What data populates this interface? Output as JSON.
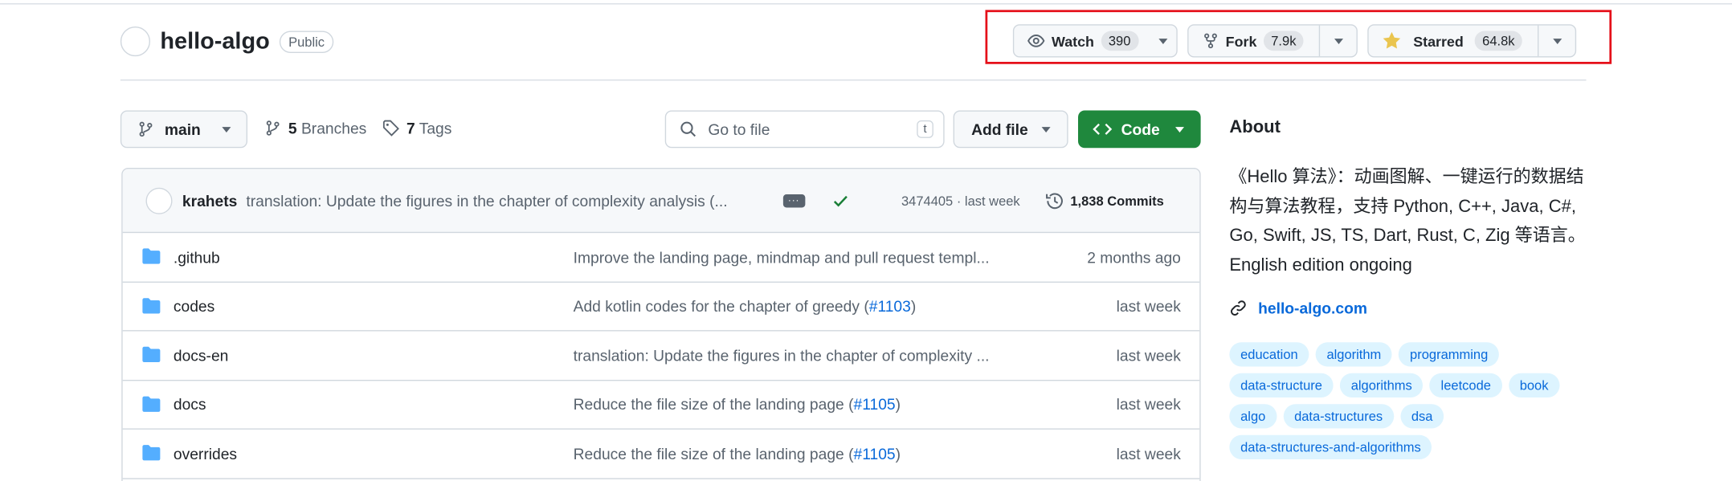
{
  "repo": {
    "name": "hello-algo",
    "visibility": "Public"
  },
  "actions": {
    "watch": {
      "label": "Watch",
      "count": "390",
      "icon": "eye-icon"
    },
    "fork": {
      "label": "Fork",
      "count": "7.9k",
      "icon": "repo-forked-icon"
    },
    "star": {
      "label": "Starred",
      "count": "64.8k",
      "icon": "star-fill-icon",
      "icon_color": "#eac54f"
    }
  },
  "toolbar": {
    "branch": "main",
    "branches_count": "5",
    "branches_label": "Branches",
    "tags_count": "7",
    "tags_label": "Tags",
    "search_placeholder": "Go to file",
    "search_shortcut": "t",
    "add_file_label": "Add file",
    "code_label": "Code"
  },
  "latest_commit": {
    "author": "krahets",
    "message": "translation: Update the figures in the chapter of complexity analysis (...",
    "sha_time": "3474405 · last week",
    "commits_count": "1,838 Commits"
  },
  "files": [
    {
      "name": ".github",
      "message": "Improve the landing page, mindmap and pull request templ...",
      "pr": "",
      "suffix": "",
      "time": "2 months ago"
    },
    {
      "name": "codes",
      "message": "Add kotlin codes for the chapter of greedy (",
      "pr": "#1103",
      "suffix": ")",
      "time": "last week"
    },
    {
      "name": "docs-en",
      "message": "translation: Update the figures in the chapter of complexity ...",
      "pr": "",
      "suffix": "",
      "time": "last week"
    },
    {
      "name": "docs",
      "message": "Reduce the file size of the landing page (",
      "pr": "#1105",
      "suffix": ")",
      "time": "last week"
    },
    {
      "name": "overrides",
      "message": "Reduce the file size of the landing page (",
      "pr": "#1105",
      "suffix": ")",
      "time": "last week"
    }
  ],
  "about": {
    "title": "About",
    "description": "《Hello 算法》：动画图解、一键运行的数据结构与算法教程，支持 Python, C++, Java, C#, Go, Swift, JS, TS, Dart, Rust, C, Zig 等语言。English edition ongoing",
    "website": "hello-algo.com",
    "topics": [
      "education",
      "algorithm",
      "programming",
      "data-structure",
      "algorithms",
      "leetcode",
      "book",
      "algo",
      "data-structures",
      "dsa",
      "data-structures-and-algorithms"
    ]
  },
  "colors": {
    "accent": "#0969da",
    "primary_button": "#1f883d",
    "highlight_box": "#e5101a",
    "folder": "#54aeff",
    "success": "#1a7f37"
  }
}
